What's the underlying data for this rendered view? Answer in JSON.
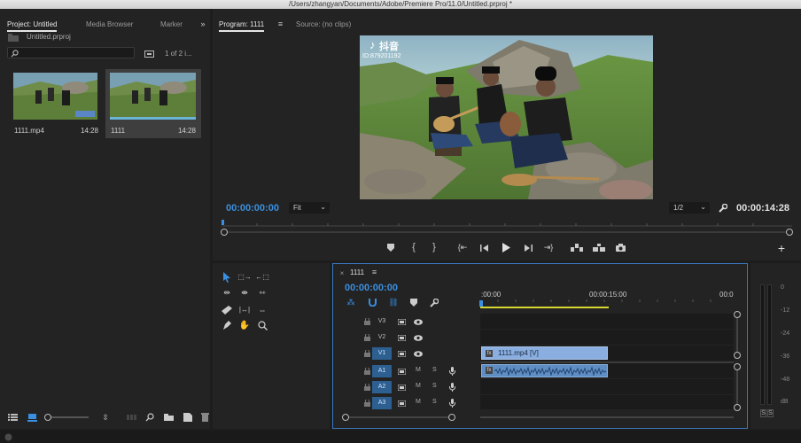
{
  "window": {
    "title": "/Users/zhangyan/Documents/Adobe/Premiere Pro/11.0/Untitled.prproj *"
  },
  "project_panel": {
    "tabs": [
      "Project: Untitled",
      "Media Browser",
      "Marker"
    ],
    "overflow_icon": "double-chevron-right-icon",
    "file_name": "Untitled.prproj",
    "search_placeholder": "",
    "item_count": "1 of 2 i...",
    "items": [
      {
        "name": "1111.mp4",
        "duration": "14:28",
        "selected": false
      },
      {
        "name": "1111",
        "duration": "14:28",
        "selected": true
      }
    ]
  },
  "program_monitor": {
    "tab_label": "Program: 1111",
    "source_tab_label": "Source: (no clips)",
    "watermark_app": "抖音",
    "watermark_id": "ID:879201192",
    "current_time": "00:00:00:00",
    "fit_option": "Fit",
    "resolution": "1/2",
    "duration": "00:00:14:28",
    "playback_icons": [
      "marker-icon",
      "in-point-icon",
      "out-point-icon",
      "go-to-in-icon",
      "step-back-icon",
      "play-icon",
      "step-forward-icon",
      "go-to-out-icon",
      "lift-icon",
      "extract-icon",
      "camera-icon"
    ],
    "add_icon": "plus-icon"
  },
  "tools": [
    "selection-tool-icon",
    "track-select-forward-icon",
    "track-select-backward-icon",
    "ripple-edit-icon",
    "rolling-edit-icon",
    "rate-stretch-icon",
    "razor-icon",
    "slip-icon",
    "slide-icon",
    "pen-icon",
    "hand-icon",
    "zoom-icon"
  ],
  "timeline": {
    "sequence_name": "1111",
    "timecode": "00:00:00:00",
    "ruler_labels": [
      ":00:00",
      "00:00:15:00",
      "00:0"
    ],
    "video_tracks": [
      {
        "name": "V3",
        "on": false
      },
      {
        "name": "V2",
        "on": false
      },
      {
        "name": "V1",
        "on": true
      }
    ],
    "audio_tracks": [
      {
        "name": "A1",
        "mute": "M",
        "solo": "S"
      },
      {
        "name": "A2",
        "mute": "M",
        "solo": "S"
      },
      {
        "name": "A3",
        "mute": "M",
        "solo": "S"
      }
    ],
    "video_clip_label": "1111.mp4 [V]",
    "audio_clip_label": "fx",
    "clip_fraction_of_view": 0.5
  },
  "audio_meter": {
    "scale": [
      "0",
      "-12",
      "-24",
      "-36",
      "-48",
      "dB"
    ],
    "solo_labels": [
      "S",
      "S"
    ]
  },
  "colors": {
    "accent_blue": "#3a8fe0",
    "clip_video": "#8aaedf",
    "clip_audio": "#5f8ec4",
    "work_area": "#d6d630",
    "panel_bg": "#232323"
  }
}
